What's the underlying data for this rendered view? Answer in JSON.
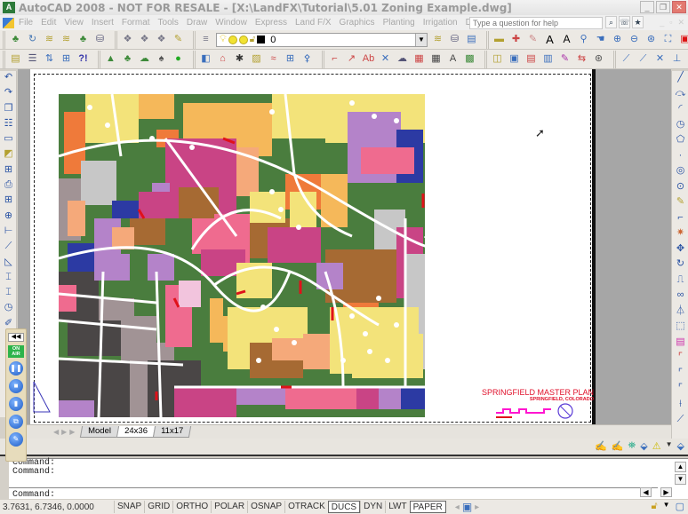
{
  "window": {
    "title": "AutoCAD 2008 - NOT FOR RESALE - [X:\\LandFX\\Tutorial\\5.01 Zoning Example.dwg]",
    "controls": [
      "_",
      "❐",
      "✕"
    ]
  },
  "menubar": {
    "items": [
      "File",
      "Edit",
      "View",
      "Insert",
      "Format",
      "Tools",
      "Draw",
      "Window",
      "Express",
      "Land F/X",
      "Graphics",
      "Planting",
      "Irrigation",
      "Details"
    ],
    "help_placeholder": "Type a question for help"
  },
  "layer_toolbar": {
    "current_layer": "0"
  },
  "drawing": {
    "title": "SPRINGFIELD MASTER PLAN",
    "subtitle": "SPRINGFIELD, COLORADO"
  },
  "layout_tabs": {
    "items": [
      "Model",
      "24x36",
      "11x17"
    ],
    "active": "24x36"
  },
  "recorder_panel": {
    "onair_label": "ON AIR"
  },
  "command": {
    "history": [
      "Command:",
      "Command:"
    ],
    "prompt": "Command:"
  },
  "statusbar": {
    "coords": "3.7631, 6.7346, 0.0000",
    "toggles": [
      {
        "label": "SNAP",
        "on": false
      },
      {
        "label": "GRID",
        "on": false
      },
      {
        "label": "ORTHO",
        "on": false
      },
      {
        "label": "POLAR",
        "on": false
      },
      {
        "label": "OSNAP",
        "on": false
      },
      {
        "label": "OTRACK",
        "on": false
      },
      {
        "label": "DUCS",
        "on": true
      },
      {
        "label": "DYN",
        "on": false
      },
      {
        "label": "LWT",
        "on": false
      },
      {
        "label": "PAPER",
        "on": true
      }
    ]
  },
  "colors": {
    "park_green": "#4a7d3e",
    "residential_yellow": "#f3e37a",
    "light_orange": "#f5b85a",
    "salmon": "#f5a97a",
    "orange": "#ef7a3a",
    "magenta": "#c94485",
    "pink": "#ef6b8f",
    "lavender": "#b483c9",
    "navy": "#2c3aa3",
    "brown": "#a66a33",
    "dark_gray": "#4a4646",
    "mauve_gray": "#a19395",
    "light_gray": "#c7c7c7",
    "title_red": "#e0112b"
  }
}
